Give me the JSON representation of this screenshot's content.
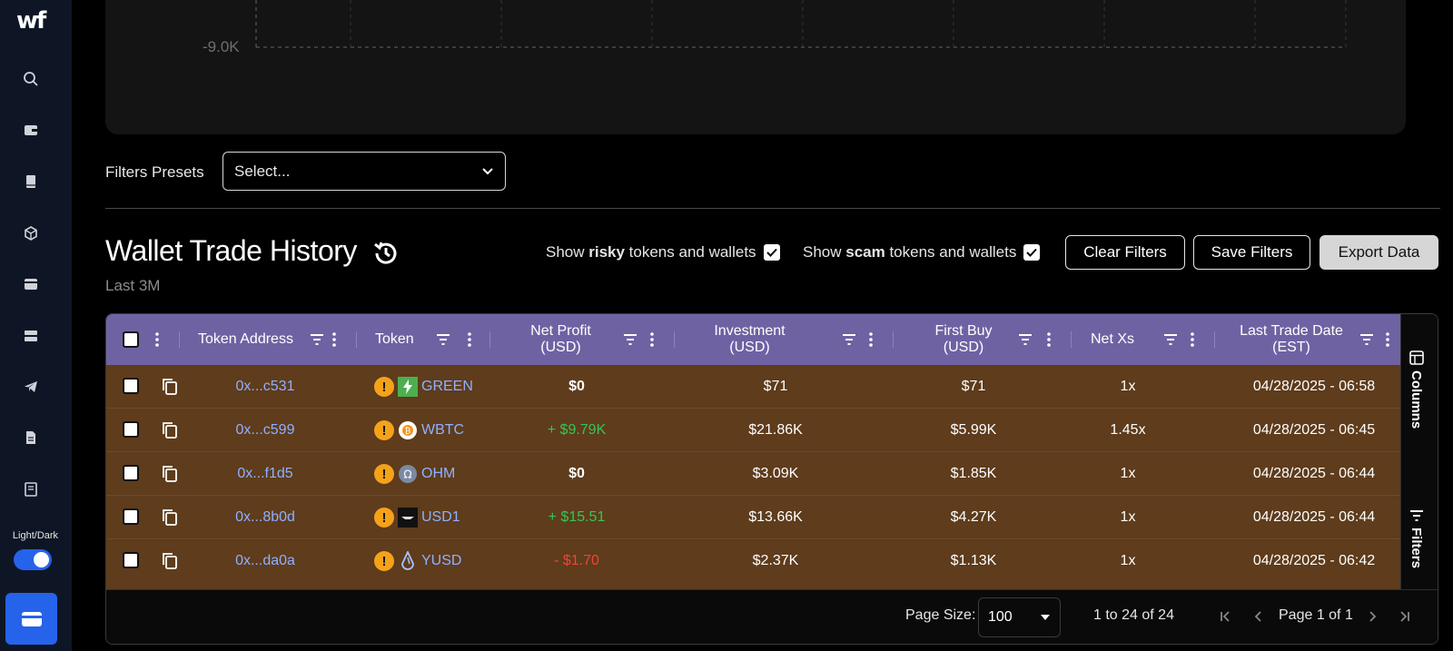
{
  "sidebar": {
    "logo": "wf",
    "theme_label": "Light/Dark",
    "nav_icons": [
      "search-icon",
      "wallet-icon",
      "book-icon",
      "cube-icon",
      "card-icon",
      "server-icon",
      "telegram-icon",
      "document-icon",
      "notebook-icon"
    ]
  },
  "chart": {
    "y_tick": "-9.0K"
  },
  "filters": {
    "presets_label": "Filters Presets",
    "select_placeholder": "Select..."
  },
  "header": {
    "title": "Wallet Trade History",
    "subtitle": "Last 3M",
    "risky_pre": "Show ",
    "risky_bold": "risky",
    "risky_post": " tokens and wallets",
    "scam_pre": "Show ",
    "scam_bold": "scam",
    "scam_post": " tokens and wallets",
    "clear_filters": "Clear Filters",
    "save_filters": "Save Filters",
    "export_data": "Export Data"
  },
  "table": {
    "columns": {
      "token_address": "Token Address",
      "token": "Token",
      "net_profit": "Net Profit (USD)",
      "investment": "Investment (USD)",
      "first_buy": "First Buy (USD)",
      "net_xs": "Net Xs",
      "last_trade_1": "Last Trade Date",
      "last_trade_2": "(EST)"
    },
    "rows": [
      {
        "address": "0x...c531",
        "symbol": "GREEN",
        "profit": "$0",
        "profit_color": "#ffffff",
        "investment": "$71",
        "first_buy": "$71",
        "net_xs": "1x",
        "last_trade": "04/28/2025 - 06:58",
        "icon": "lightning-icon"
      },
      {
        "address": "0x...c599",
        "symbol": "WBTC",
        "profit": "+ $9.79K",
        "profit_color": "#35c653",
        "investment": "$21.86K",
        "first_buy": "$5.99K",
        "net_xs": "1.45x",
        "last_trade": "04/28/2025 - 06:45",
        "icon": "bitcoin-icon"
      },
      {
        "address": "0x...f1d5",
        "symbol": "OHM",
        "profit": "$0",
        "profit_color": "#ffffff",
        "investment": "$3.09K",
        "first_buy": "$1.85K",
        "net_xs": "1x",
        "last_trade": "04/28/2025 - 06:44",
        "icon": "omega-icon"
      },
      {
        "address": "0x...8b0d",
        "symbol": "USD1",
        "profit": "+ $15.51",
        "profit_color": "#35c653",
        "investment": "$13.66K",
        "first_buy": "$4.27K",
        "net_xs": "1x",
        "last_trade": "04/28/2025 - 06:44",
        "icon": "usd1-icon"
      },
      {
        "address": "0x...da0a",
        "symbol": "YUSD",
        "profit": "- $1.70",
        "profit_color": "#f04438",
        "investment": "$2.37K",
        "first_buy": "$1.13K",
        "net_xs": "1x",
        "last_trade": "04/28/2025 - 06:42",
        "icon": "drop-icon"
      }
    ],
    "side_columns": "Columns",
    "side_filters": "Filters"
  },
  "pagination": {
    "page_size_label": "Page Size:",
    "page_size": "100",
    "range": "1 to 24 of 24",
    "page": "Page 1 of 1"
  },
  "colors": {
    "accent": "#2563eb",
    "header_bg": "#6f62a3",
    "row_bg": "#5e3c1c",
    "link": "#8fb0ff"
  }
}
